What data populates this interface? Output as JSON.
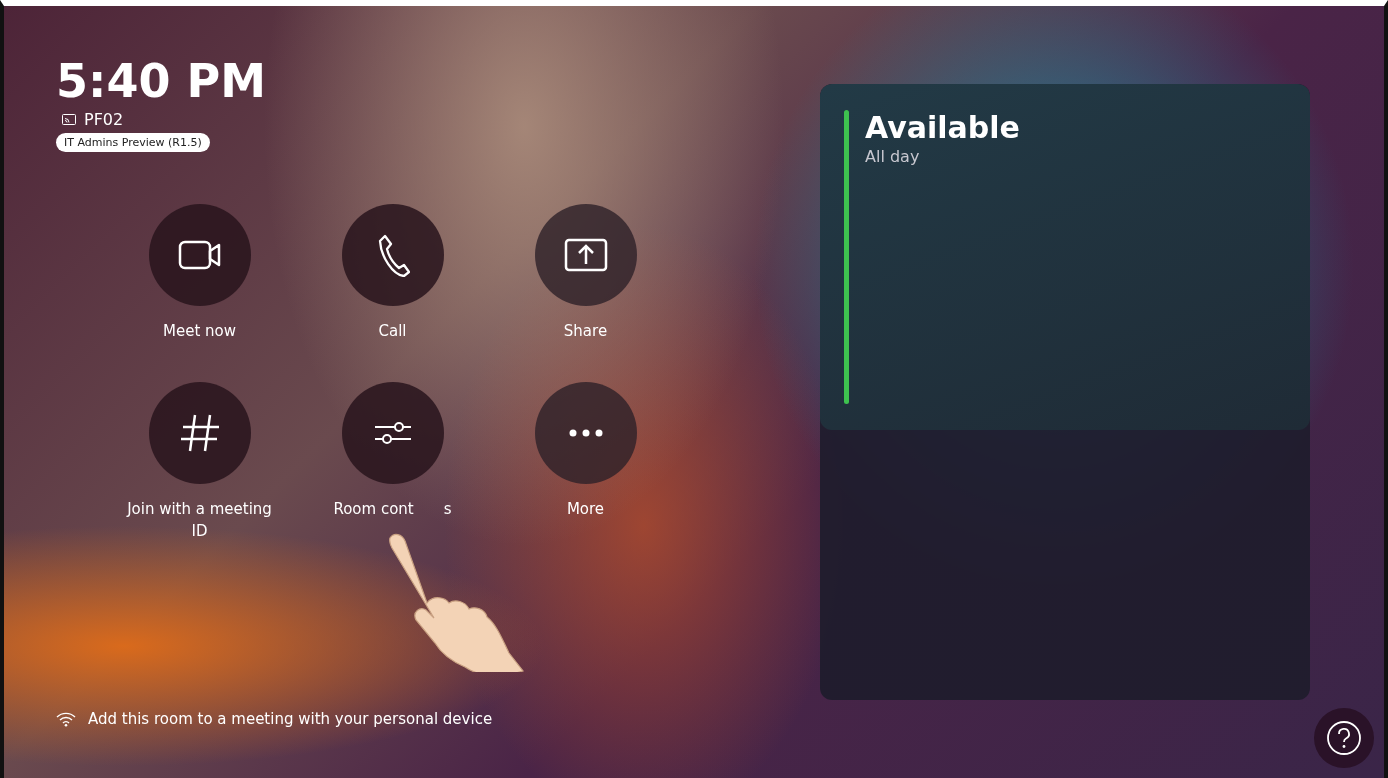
{
  "clock": {
    "time": "5:40 PM",
    "room": "PF02",
    "badge": "IT Admins Preview (R1.5)"
  },
  "actions": [
    {
      "kind": "video",
      "label": "Meet now"
    },
    {
      "kind": "phone",
      "label": "Call"
    },
    {
      "kind": "share",
      "label": "Share"
    },
    {
      "kind": "hash",
      "label": "Join with a meeting ID"
    },
    {
      "kind": "sliders",
      "label": "Room cont",
      "label_tail": "s"
    },
    {
      "kind": "more",
      "label": "More"
    }
  ],
  "proximity": {
    "text": "Add this room to a meeting with your personal device"
  },
  "calendar": {
    "status": "Available",
    "subtitle": "All day",
    "color": "#3ec24f"
  }
}
